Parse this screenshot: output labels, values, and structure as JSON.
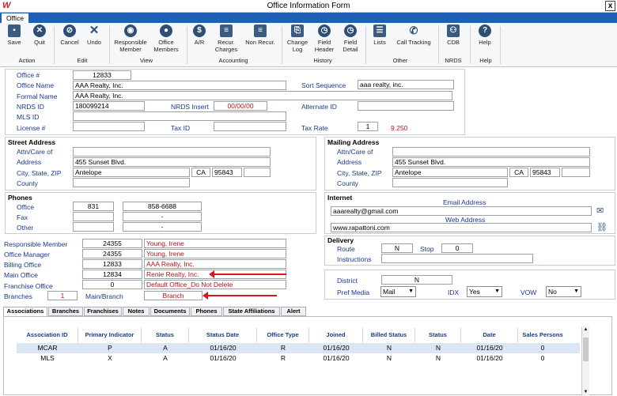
{
  "window": {
    "title": "Office Information Form",
    "logo": "W",
    "close": "x"
  },
  "ribbon": {
    "tab": "Office",
    "buttons": [
      {
        "label": "Save",
        "icon": "save-icon"
      },
      {
        "label": "Quit",
        "icon": "quit-icon"
      },
      {
        "label": "Cancel",
        "icon": "cancel-icon"
      },
      {
        "label": "Undo",
        "icon": "undo-icon"
      },
      {
        "label": "Responsible\nMember",
        "icon": "member-search-icon"
      },
      {
        "label": "Office\nMembers",
        "icon": "office-members-icon"
      },
      {
        "label": "A/R",
        "icon": "dollar-icon"
      },
      {
        "label": "Recur.\nCharges",
        "icon": "money-icon"
      },
      {
        "label": "Non Recur.",
        "icon": "money-icon"
      },
      {
        "label": "Change\nLog",
        "icon": "change-log-icon"
      },
      {
        "label": "Field\nHeader",
        "icon": "clock-icon"
      },
      {
        "label": "Field\nDetail",
        "icon": "clock-icon"
      },
      {
        "label": "Lists",
        "icon": "list-icon"
      },
      {
        "label": "Call Tracking",
        "icon": "phone-icon"
      },
      {
        "label": "CDB",
        "icon": "network-icon"
      },
      {
        "label": "Help",
        "icon": "help-icon"
      }
    ],
    "groups": [
      "Action",
      "Edit",
      "View",
      "Accounting",
      "History",
      "Other",
      "NRDS",
      "Help"
    ]
  },
  "office": {
    "office_num_label": "Office #",
    "office_num": "12833",
    "name_label": "Office Name",
    "name": "AAA Realty, Inc.",
    "sort_label": "Sort Sequence",
    "sort": "aaa realty, inc.",
    "formal_label": "Formal Name",
    "formal": "AAA Realty, Inc.",
    "nrds_label": "NRDS ID",
    "nrds": "180099214",
    "nrds_insert_label": "NRDS Insert",
    "nrds_insert": "00/00/00",
    "alt_label": "Alternate ID",
    "alt": "",
    "mls_label": "MLS ID",
    "mls": "",
    "license_label": "License #",
    "license": "",
    "taxid_label": "Tax ID",
    "taxid": "",
    "taxrate_label": "Tax Rate",
    "taxrate_code": "1",
    "taxrate": "9.250"
  },
  "street": {
    "title": "Street Address",
    "attn_label": "Attn/Care of",
    "attn": "",
    "addr_label": "Address",
    "addr": "455 Sunset Blvd.",
    "csz_label": "City, State, ZIP",
    "city": "Antelope",
    "state": "CA",
    "zip": "95843",
    "zip4": "",
    "county_label": "County",
    "county": ""
  },
  "mailing": {
    "title": "Mailing Address",
    "attn_label": "Attn/Care of",
    "attn": "",
    "addr_label": "Address",
    "addr": "455 Sunset Blvd.",
    "csz_label": "City, State, ZIP",
    "city": "Antelope",
    "state": "CA",
    "zip": "95843",
    "zip4": "",
    "county_label": "County",
    "county": ""
  },
  "phones": {
    "title": "Phones",
    "office_label": "Office",
    "office_area": "831",
    "office_num": "858-6688",
    "fax_label": "Fax",
    "fax_area": "",
    "fax_num": "-",
    "other_label": "Other",
    "other_area": "",
    "other_num": "-"
  },
  "internet": {
    "title": "Internet",
    "email_label": "Email Address",
    "email": "aaarealty@gmail.com",
    "web_label": "Web Address",
    "web": "www.rapattoni.com"
  },
  "members": {
    "resp_label": "Responsible Member",
    "resp_id": "24355",
    "resp_name": "Young, Irene",
    "mgr_label": "Office Manager",
    "mgr_id": "24355",
    "mgr_name": "Young, Irene",
    "billing_label": "Billing Office",
    "billing_id": "12833",
    "billing_name": "AAA Realty, Inc.",
    "main_label": "Main Office",
    "main_id": "12834",
    "main_name": "Renie Realty, Inc.",
    "franchise_label": "Franchise Office",
    "franchise_id": "0",
    "franchise_name": "Default Office_Do Not Delete",
    "branches_label": "Branches",
    "branches": "1",
    "mainbranch_label": "Main/Branch",
    "mainbranch": "Branch"
  },
  "delivery": {
    "title": "Delivery",
    "route_label": "Route",
    "route": "N",
    "stop_label": "Stop",
    "stop": "0",
    "instr_label": "Instructions",
    "instr": ""
  },
  "district": {
    "district_label": "District",
    "district": "N",
    "pref_label": "Pref Media",
    "pref": "Mail",
    "idx_label": "IDX",
    "idx": "Yes",
    "vow_label": "VOW",
    "vow": "No"
  },
  "tabs": [
    "Associations",
    "Branches",
    "Franchises",
    "Notes",
    "Documents",
    "Phones",
    "State Affiliations",
    "Alert"
  ],
  "grid": {
    "headers": [
      "Association  ID",
      "Primary Indicator",
      "Status",
      "Status Date",
      "Office Type",
      "Joined",
      "Billed Status",
      "Status",
      "Date",
      "Sales  Persons"
    ],
    "rows": [
      [
        "MCAR",
        "P",
        "A",
        "01/16/20",
        "R",
        "01/16/20",
        "N",
        "N",
        "01/16/20",
        "0"
      ],
      [
        "MLS",
        "X",
        "A",
        "01/16/20",
        "R",
        "01/16/20",
        "N",
        "N",
        "01/16/20",
        "0"
      ]
    ]
  }
}
